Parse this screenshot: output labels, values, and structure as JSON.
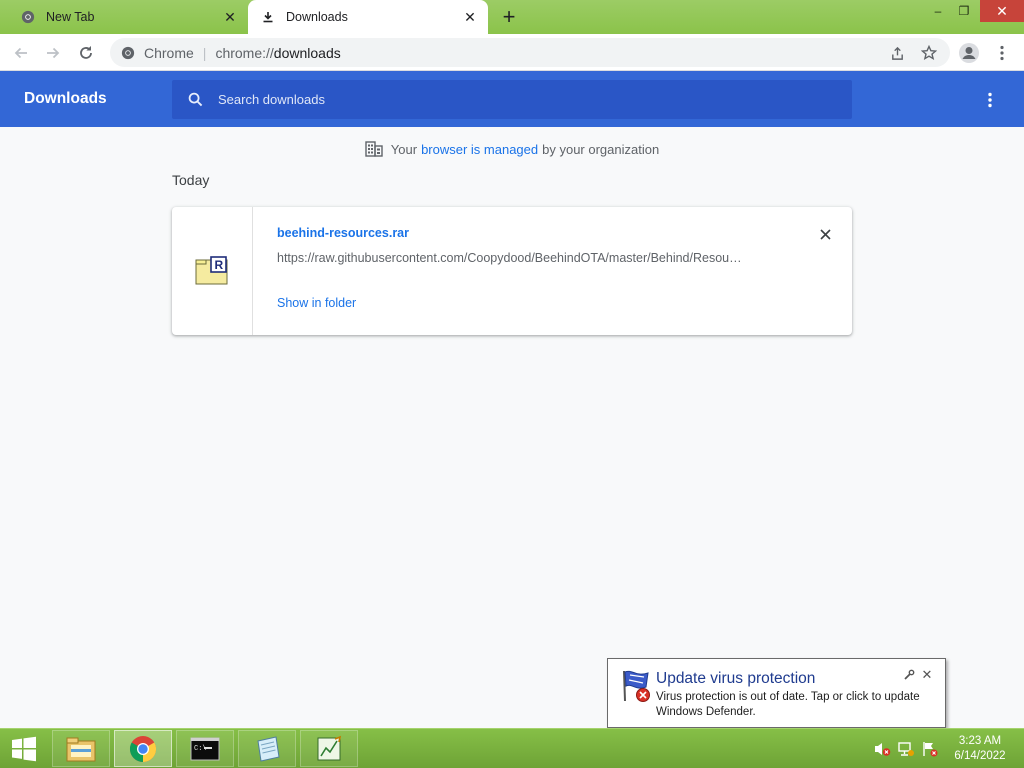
{
  "browser": {
    "tabs": [
      {
        "title": "New Tab",
        "icon": "chrome-icon",
        "active": false
      },
      {
        "title": "Downloads",
        "icon": "download-icon",
        "active": true
      }
    ],
    "new_tab_symbol": "+",
    "window_controls": {
      "minimize": "–",
      "maximize": "❐",
      "close": "✕"
    }
  },
  "toolbar": {
    "scheme_label": "Chrome",
    "url_dim": "chrome://",
    "url_path": "downloads"
  },
  "downloads_page": {
    "title": "Downloads",
    "search_placeholder": "Search downloads",
    "managed_notice": {
      "prefix": "Your",
      "link": "browser is managed",
      "suffix": "by your organization"
    },
    "date_group": "Today",
    "items": [
      {
        "file_name": "beehind-resources.rar",
        "url": "https://raw.githubusercontent.com/Coopydood/BeehindOTA/master/Behind/Resou…",
        "action": "Show in folder",
        "icon": "rar-archive-icon"
      }
    ]
  },
  "notification": {
    "title": "Update virus protection",
    "text": "Virus protection is out of date. Tap or click to update Windows Defender.",
    "icon": "defender-flag-icon"
  },
  "taskbar": {
    "apps": [
      {
        "name": "file-explorer",
        "icon": "folder-icon",
        "active": false
      },
      {
        "name": "chrome",
        "icon": "chrome-icon",
        "active": true
      },
      {
        "name": "command-prompt",
        "icon": "cmd-icon",
        "active": false
      },
      {
        "name": "notepad",
        "icon": "notepad-icon",
        "active": false
      },
      {
        "name": "graph-app",
        "icon": "graph-icon",
        "active": false
      }
    ],
    "clock": {
      "time": "3:23 AM",
      "date": "6/14/2022"
    }
  },
  "colors": {
    "accent": "#3367d6",
    "link": "#1a73e8",
    "frame": "#8bc34a",
    "taskbar": "#7ab23f"
  }
}
